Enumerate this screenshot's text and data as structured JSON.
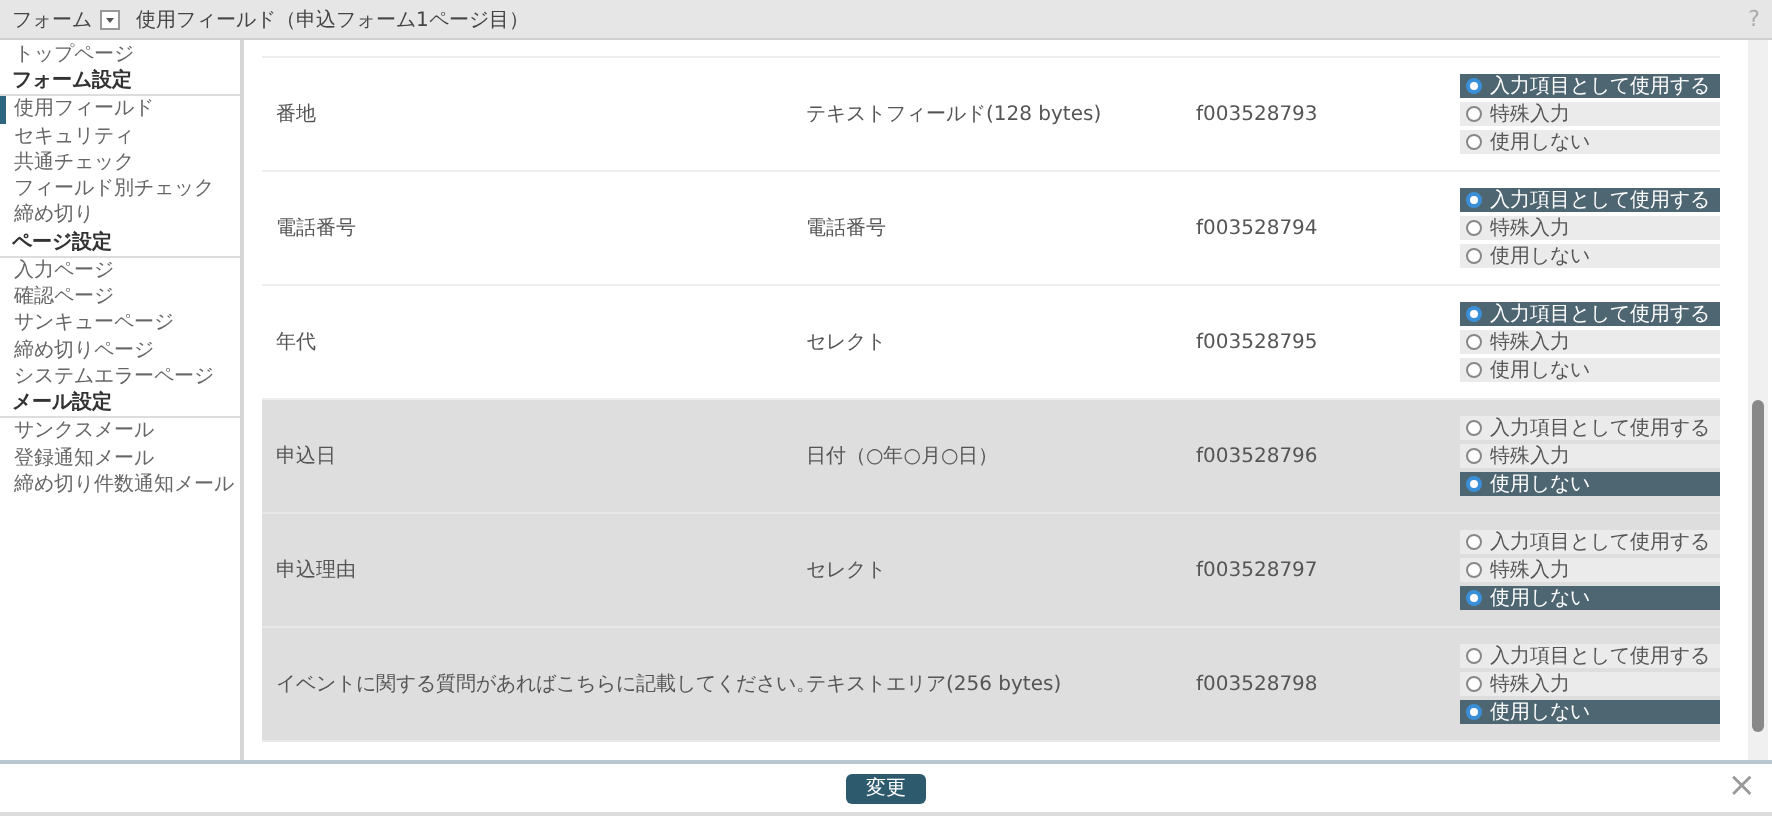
{
  "title_bar": {
    "menu_label": "フォーム",
    "title": "使用フィールド（申込フォーム1ページ目）",
    "help": "?"
  },
  "sidebar": {
    "top_item": {
      "label": "トップページ",
      "selected": false
    },
    "sections": [
      {
        "heading": "フォーム設定",
        "items": [
          {
            "label": "使用フィールド",
            "selected": true
          },
          {
            "label": "セキュリティ",
            "selected": false
          },
          {
            "label": "共通チェック",
            "selected": false
          },
          {
            "label": "フィールド別チェック",
            "selected": false
          },
          {
            "label": "締め切り",
            "selected": false
          }
        ]
      },
      {
        "heading": "ページ設定",
        "items": [
          {
            "label": "入力ページ",
            "selected": false
          },
          {
            "label": "確認ページ",
            "selected": false
          },
          {
            "label": "サンキューページ",
            "selected": false
          },
          {
            "label": "締め切りページ",
            "selected": false
          },
          {
            "label": "システムエラーページ",
            "selected": false
          }
        ]
      },
      {
        "heading": "メール設定",
        "items": [
          {
            "label": "サンクスメール",
            "selected": false
          },
          {
            "label": "登録通知メール",
            "selected": false
          },
          {
            "label": "締め切り件数通知メール",
            "selected": false
          }
        ]
      }
    ]
  },
  "fields": [
    {
      "name": "番地",
      "type": "テキストフィールド(128 bytes)",
      "id": "f003528793",
      "options": [
        {
          "label": "入力項目として使用する",
          "selected": true
        },
        {
          "label": "特殊入力",
          "selected": false
        },
        {
          "label": "使用しない",
          "selected": false
        }
      ]
    },
    {
      "name": "電話番号",
      "type": "電話番号",
      "id": "f003528794",
      "options": [
        {
          "label": "入力項目として使用する",
          "selected": true
        },
        {
          "label": "特殊入力",
          "selected": false
        },
        {
          "label": "使用しない",
          "selected": false
        }
      ]
    },
    {
      "name": "年代",
      "type": "セレクト",
      "id": "f003528795",
      "options": [
        {
          "label": "入力項目として使用する",
          "selected": true
        },
        {
          "label": "特殊入力",
          "selected": false
        },
        {
          "label": "使用しない",
          "selected": false
        }
      ]
    },
    {
      "name": "申込日",
      "type": "日付（○年○月○日）",
      "id": "f003528796",
      "options": [
        {
          "label": "入力項目として使用する",
          "selected": false
        },
        {
          "label": "特殊入力",
          "selected": false
        },
        {
          "label": "使用しない",
          "selected": true
        }
      ]
    },
    {
      "name": "申込理由",
      "type": "セレクト",
      "id": "f003528797",
      "options": [
        {
          "label": "入力項目として使用する",
          "selected": false
        },
        {
          "label": "特殊入力",
          "selected": false
        },
        {
          "label": "使用しない",
          "selected": true
        }
      ]
    },
    {
      "name": "イベントに関する質問があればこちらに記載してください。",
      "type": "テキストエリア(256 bytes)",
      "id": "f003528798",
      "options": [
        {
          "label": "入力項目として使用する",
          "selected": false
        },
        {
          "label": "特殊入力",
          "selected": false
        },
        {
          "label": "使用しない",
          "selected": true
        }
      ]
    }
  ],
  "footer": {
    "button": "変更",
    "close": "×"
  }
}
